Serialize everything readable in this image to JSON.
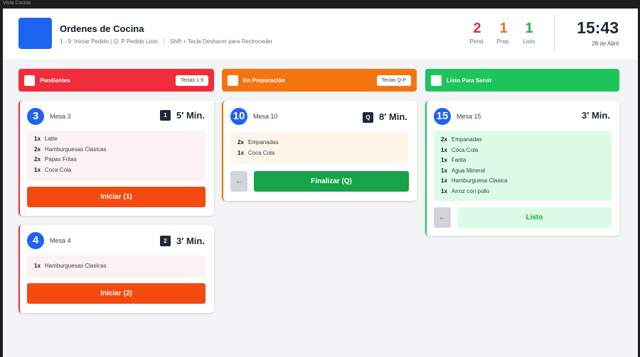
{
  "window_title": "Vista Cocina",
  "header": {
    "title": "Ordenes de Cocina",
    "hint1": "1 - 9: Iniciar Pedido | Q- P Pedido Listo",
    "hint2": "Shift + Tecla Deshacer para Rectroceder",
    "stats": [
      {
        "value": "2",
        "label": "Pend.",
        "color": "#e5303a"
      },
      {
        "value": "1",
        "label": "Prep.",
        "color": "#f36f16"
      },
      {
        "value": "1",
        "label": "Listo",
        "color": "#22b14c"
      }
    ],
    "time": "15:43",
    "date": "28 de Abril"
  },
  "columns": [
    {
      "title": "Pendientes",
      "keys": "Teclas 1-9",
      "color": "#ef2d3b"
    },
    {
      "title": "En Preparación",
      "keys": "Teclas Q-P",
      "color": "#f5740f"
    },
    {
      "title": "Listo Para Servir",
      "keys": "",
      "color": "#1dc45a"
    }
  ],
  "pending": [
    {
      "number": "3",
      "table": "Mesa 3",
      "key": "1",
      "time": "5′ Min.",
      "items": [
        {
          "qty": "1x",
          "name": "Latte"
        },
        {
          "qty": "2x",
          "name": "Hamburguesas Clasicas"
        },
        {
          "qty": "2x",
          "name": "Papas Fritas"
        },
        {
          "qty": "1x",
          "name": "Coca Cola"
        }
      ],
      "action": "Iniciar (1)"
    },
    {
      "number": "4",
      "table": "Mesa 4",
      "key": "2",
      "time": "3′ Min.",
      "items": [
        {
          "qty": "1x",
          "name": "Hamburguesas Clasicas"
        }
      ],
      "action": "Iniciar (2)"
    }
  ],
  "preparing": [
    {
      "number": "10",
      "table": "Mesa 10",
      "key": "Q",
      "time": "8′ Min.",
      "items": [
        {
          "qty": "2x",
          "name": "Empanadas"
        },
        {
          "qty": "1x",
          "name": "Coca Cola"
        }
      ],
      "back": "←",
      "action": "Finalizar (Q)"
    }
  ],
  "ready": [
    {
      "number": "15",
      "table": "Mesa 15",
      "time": "3′ Min.",
      "items": [
        {
          "qty": "2x",
          "name": "Empanadas"
        },
        {
          "qty": "1x",
          "name": "Coca Cola"
        },
        {
          "qty": "1x",
          "name": "Fanta"
        },
        {
          "qty": "1x",
          "name": "Agua Mineral"
        },
        {
          "qty": "1x",
          "name": "Hamburguesa Clasica"
        },
        {
          "qty": "1x",
          "name": "Arroz con pollo"
        }
      ],
      "back": "←",
      "action": "Listo"
    }
  ]
}
